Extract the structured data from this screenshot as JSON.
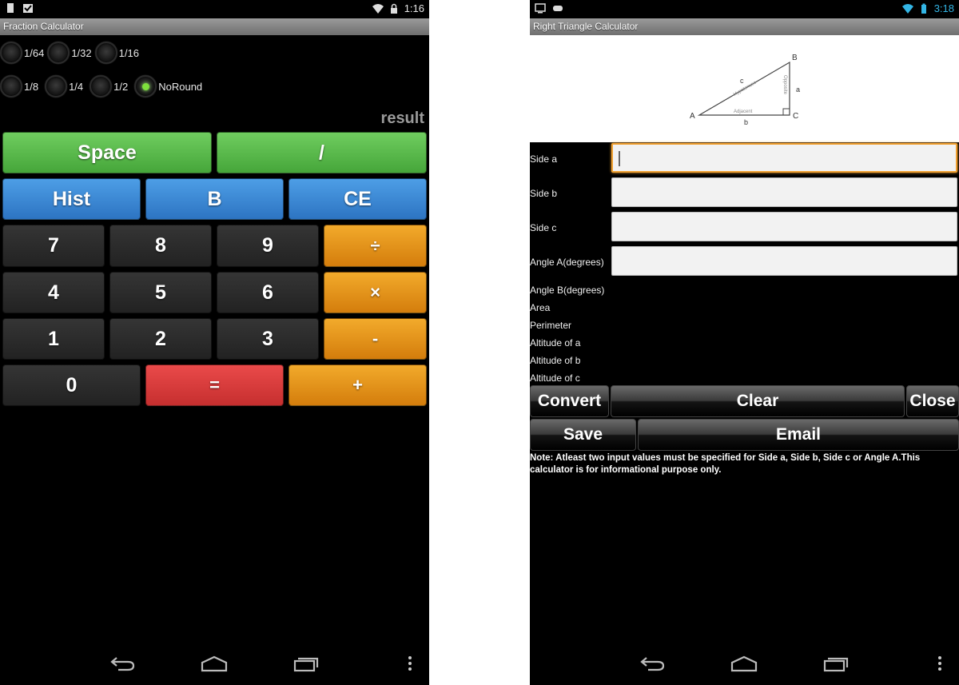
{
  "left": {
    "status": {
      "time": "1:16",
      "icons": [
        "battery-icon",
        "checkbox-notification-icon",
        "wifi-icon",
        "lock-icon"
      ]
    },
    "app_title": "Fraction Calculator",
    "rounding_options_row1": [
      {
        "label": "1/64",
        "selected": false
      },
      {
        "label": "1/32",
        "selected": false
      },
      {
        "label": "1/16",
        "selected": false
      }
    ],
    "rounding_options_row2": [
      {
        "label": "1/8",
        "selected": false
      },
      {
        "label": "1/4",
        "selected": false
      },
      {
        "label": "1/2",
        "selected": false
      },
      {
        "label": "NoRound",
        "selected": true
      }
    ],
    "result_label": "result",
    "buttons": {
      "space": "Space",
      "slash": "/",
      "hist": "Hist",
      "b": "B",
      "ce": "CE",
      "seven": "7",
      "eight": "8",
      "nine": "9",
      "divide": "÷",
      "four": "4",
      "five": "5",
      "six": "6",
      "multiply": "×",
      "one": "1",
      "two": "2",
      "three": "3",
      "minus": "-",
      "zero": "0",
      "equals": "=",
      "plus": "+"
    },
    "colors": {
      "green": "#56b848",
      "blue": "#3a85d4",
      "orange": "#e8961c",
      "red": "#d83c3c",
      "dark": "#2a2a2a"
    }
  },
  "right": {
    "status": {
      "time": "3:18",
      "icons": [
        "monitor-icon",
        "gamepad-icon",
        "wifi-icon",
        "battery-icon"
      ]
    },
    "app_title": "Right Triangle Calculator",
    "diagram": {
      "vertex_a": "A",
      "vertex_b": "B",
      "vertex_c": "C",
      "side_a": "a",
      "side_b": "b",
      "side_c": "c",
      "hypotenuse": "Hypotenuse",
      "opposite": "Opposite",
      "adjacent": "Adjacent"
    },
    "inputs": [
      {
        "label": "Side a",
        "value": "",
        "focused": true
      },
      {
        "label": "Side b",
        "value": ""
      },
      {
        "label": "Side c",
        "value": ""
      },
      {
        "label": "Angle A(degrees)",
        "value": ""
      }
    ],
    "outputs": [
      "Angle B(degrees)",
      "Area",
      "Perimeter",
      "Altitude of a",
      "Altitude of b",
      "Altitude of c"
    ],
    "buttons": {
      "convert": "Convert",
      "clear": "Clear",
      "close": "Close",
      "save": "Save",
      "email": "Email"
    },
    "note": "Note: Atleast two input values must be specified for Side a, Side b, Side c or Angle A.This calculator is for informational purpose only.",
    "colors": {
      "clock": "#33b5e5",
      "focus": "#f0a030"
    }
  }
}
